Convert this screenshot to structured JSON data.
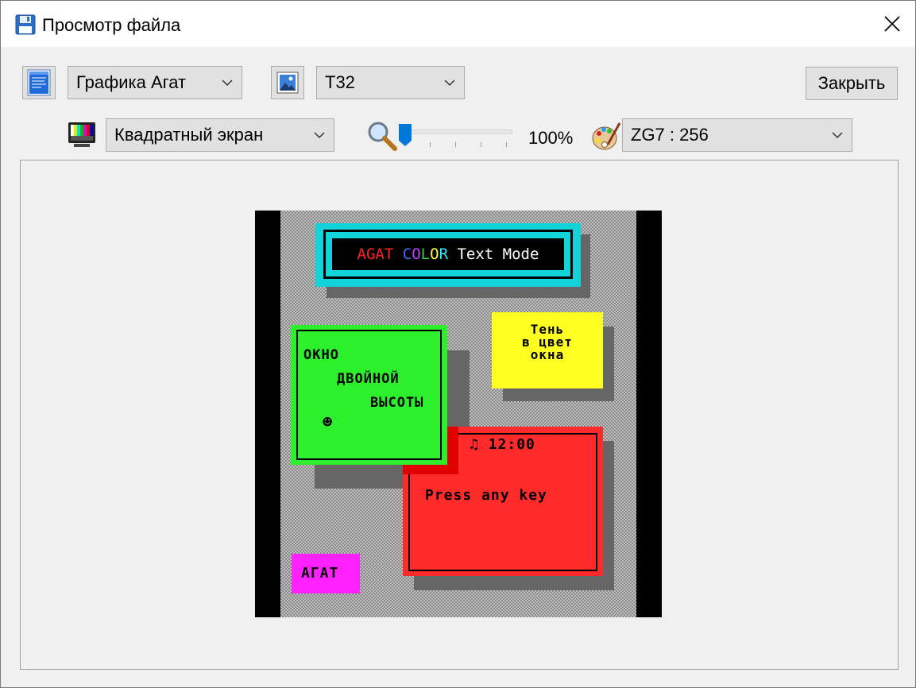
{
  "window": {
    "title": "Просмотр файла"
  },
  "toolbar": {
    "format_select": {
      "value": "Графика Агат"
    },
    "mode_select": {
      "value": "T32"
    },
    "close_button": "Закрыть",
    "screen_select": {
      "value": "Квадратный экран"
    },
    "zoom": {
      "value": 100,
      "label": "100%",
      "fraction": 0.0
    },
    "palette_select": {
      "value": "ZG7 : 256"
    }
  },
  "preview": {
    "title_banner": {
      "word1": "AGAT",
      "word1_color": "#ff2020",
      "word2_letters": [
        {
          "ch": "C",
          "color": "#3a6bff"
        },
        {
          "ch": "O",
          "color": "#c040ff"
        },
        {
          "ch": "L",
          "color": "#30d030"
        },
        {
          "ch": "O",
          "color": "#ffff30"
        },
        {
          "ch": "R",
          "color": "#30e8ff"
        }
      ],
      "rest": "Text Mode"
    },
    "green_window": {
      "line1": "ОКНО",
      "line2": "ДВОЙНОЙ",
      "line3": "ВЫСОТЫ",
      "glyph": "☻"
    },
    "yellow_window": {
      "line1": "Тень",
      "line2": "в цвет",
      "line3": "окна"
    },
    "red_window": {
      "bell": "♫",
      "time": "12:00",
      "message": "Press any key"
    },
    "magenta_window": {
      "label": "АГАТ"
    }
  },
  "colors": {
    "cyan": "#11d3d9",
    "green": "#2cf02c",
    "yellow": "#ffff22",
    "red": "#ff2a2a",
    "magenta": "#ff22ff"
  }
}
